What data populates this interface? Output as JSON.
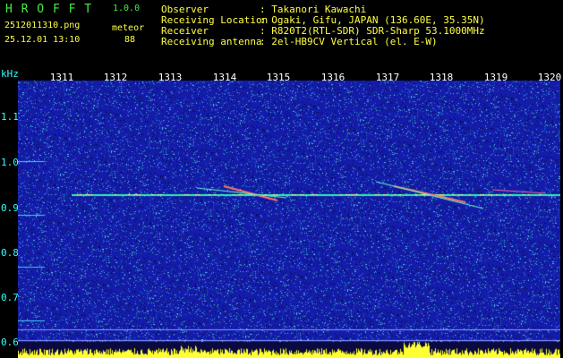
{
  "header": {
    "app_name": "H R O F F T",
    "version": "1.0.0",
    "filename": "2512011310.png",
    "mode": "meteor",
    "datetime": "25.12.01 13:10",
    "count": "88"
  },
  "station": {
    "labels": [
      "Observer",
      "Receiving Location",
      "Receiver",
      "Receiving antenna"
    ],
    "values": [
      ": Takanori Kawachi",
      ": Ogaki, Gifu, JAPAN (136.60E, 35.35N)",
      ": R820T2(RTL-SDR) SDR-Sharp 53.1000MHz",
      ": 2el-HB9CV Vertical (el. E-W)"
    ]
  },
  "axis": {
    "y_unit": "kHz",
    "y_ticks": [
      "1.1",
      "1.0",
      "0.9",
      "0.8",
      "0.7",
      "0.6"
    ],
    "x_ticks": [
      "1311",
      "1312",
      "1313",
      "1314",
      "1315",
      "1316",
      "1317",
      "1318",
      "1319",
      "1320"
    ]
  },
  "colors": {
    "background": "#000000",
    "spectrogram_base": "#1a1fa8",
    "carrier": "#33ffaa",
    "header_green": "#44ee44",
    "axis_cyan": "#33ffff",
    "level_yellow": "#ffff33"
  }
}
